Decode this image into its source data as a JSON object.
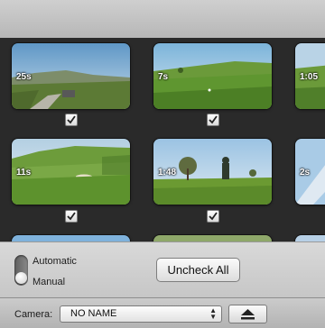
{
  "clips": [
    {
      "duration": "25s",
      "checked": true
    },
    {
      "duration": "7s",
      "checked": true
    },
    {
      "duration": "1:05",
      "checked": true
    },
    {
      "duration": "11s",
      "checked": true
    },
    {
      "duration": "1:48",
      "checked": true
    },
    {
      "duration": "2s",
      "checked": true
    }
  ],
  "import_mode": {
    "automatic_label": "Automatic",
    "manual_label": "Manual",
    "selected": "Manual"
  },
  "buttons": {
    "uncheck_all": "Uncheck All"
  },
  "camera": {
    "label": "Camera:",
    "selected": "NO NAME"
  }
}
